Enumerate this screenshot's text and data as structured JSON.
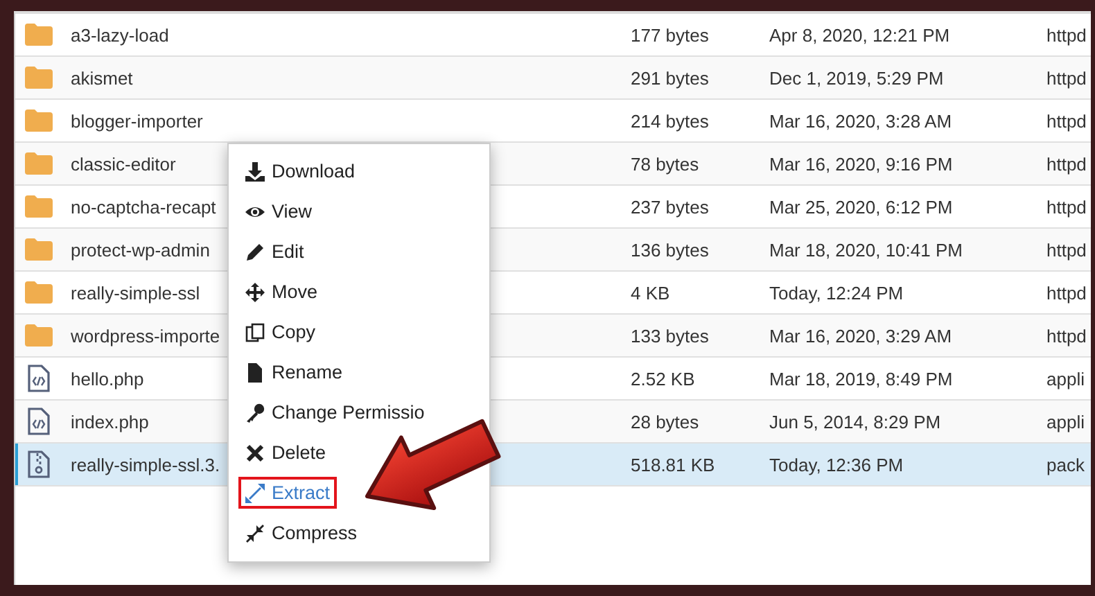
{
  "file_table": {
    "rows": [
      {
        "kind": "folder",
        "name": "a3-lazy-load",
        "size": "177 bytes",
        "modified": "Apr 8, 2020, 12:21 PM",
        "type": "httpd",
        "selected": false
      },
      {
        "kind": "folder",
        "name": "akismet",
        "size": "291 bytes",
        "modified": "Dec 1, 2019, 5:29 PM",
        "type": "httpd",
        "selected": false
      },
      {
        "kind": "folder",
        "name": "blogger-importer",
        "size": "214 bytes",
        "modified": "Mar 16, 2020, 3:28 AM",
        "type": "httpd",
        "selected": false
      },
      {
        "kind": "folder",
        "name": "classic-editor",
        "size": "78 bytes",
        "modified": "Mar 16, 2020, 9:16 PM",
        "type": "httpd",
        "selected": false
      },
      {
        "kind": "folder",
        "name": "no-captcha-recapt",
        "size": "237 bytes",
        "modified": "Mar 25, 2020, 6:12 PM",
        "type": "httpd",
        "selected": false
      },
      {
        "kind": "folder",
        "name": "protect-wp-admin",
        "size": "136 bytes",
        "modified": "Mar 18, 2020, 10:41 PM",
        "type": "httpd",
        "selected": false
      },
      {
        "kind": "folder",
        "name": "really-simple-ssl",
        "size": "4 KB",
        "modified": "Today, 12:24 PM",
        "type": "httpd",
        "selected": false
      },
      {
        "kind": "folder",
        "name": "wordpress-importe",
        "size": "133 bytes",
        "modified": "Mar 16, 2020, 3:29 AM",
        "type": "httpd",
        "selected": false
      },
      {
        "kind": "code",
        "name": "hello.php",
        "size": "2.52 KB",
        "modified": "Mar 18, 2019, 8:49 PM",
        "type": "appli",
        "selected": false
      },
      {
        "kind": "code",
        "name": "index.php",
        "size": "28 bytes",
        "modified": "Jun 5, 2014, 8:29 PM",
        "type": "appli",
        "selected": false
      },
      {
        "kind": "archive",
        "name": "really-simple-ssl.3.",
        "size": "518.81 KB",
        "modified": "Today, 12:36 PM",
        "type": "pack",
        "selected": true
      }
    ]
  },
  "context_menu": {
    "items": [
      {
        "kind": "download",
        "label": "Download",
        "highlighted": false
      },
      {
        "kind": "view",
        "label": "View",
        "highlighted": false
      },
      {
        "kind": "edit",
        "label": "Edit",
        "highlighted": false
      },
      {
        "kind": "move",
        "label": "Move",
        "highlighted": false
      },
      {
        "kind": "copy",
        "label": "Copy",
        "highlighted": false
      },
      {
        "kind": "rename",
        "label": "Rename",
        "highlighted": false
      },
      {
        "kind": "key",
        "label": "Change Permissio",
        "highlighted": false
      },
      {
        "kind": "delete",
        "label": "Delete",
        "highlighted": false
      },
      {
        "kind": "extract",
        "label": "Extract",
        "highlighted": true
      },
      {
        "kind": "compress",
        "label": "Compress",
        "highlighted": false
      }
    ]
  }
}
